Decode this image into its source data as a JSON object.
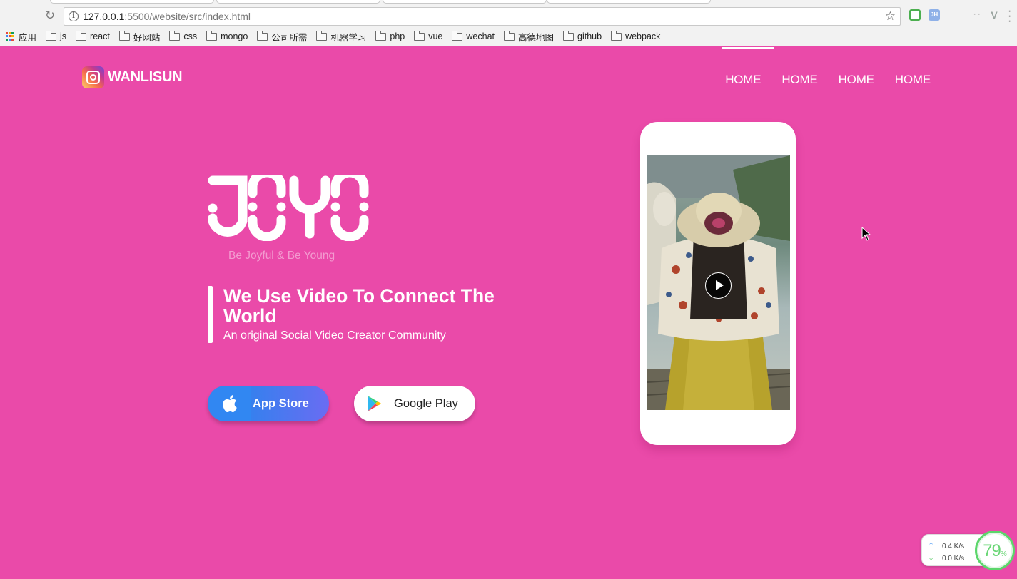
{
  "browser": {
    "url_host": "127.0.0.1",
    "url_rest": ":5500/website/src/index.html",
    "bookmarks": [
      "应用",
      "js",
      "react",
      "好网站",
      "css",
      "mongo",
      "公司所需",
      "机器学习",
      "php",
      "vue",
      "wechat",
      "高德地图",
      "github",
      "webpack"
    ],
    "extension_jh": "JH"
  },
  "header": {
    "logo_text": "WANLISUN",
    "nav": [
      "HOME",
      "HOME",
      "HOME",
      "HOME"
    ]
  },
  "hero": {
    "brand_word": "JOYO",
    "tagline": "Be Joyful & Be Young",
    "headline": "We Use Video To Connect The World",
    "subline": "An original Social Video Creator Community",
    "buttons": {
      "appstore_label": "App Store",
      "google_label": "Google Play"
    }
  },
  "phone": {
    "video_state": "paused"
  },
  "widget": {
    "upload_speed": "0.4 K/s",
    "download_speed": "0.0 K/s",
    "cpu_percent": "79",
    "percent_sign": "%"
  },
  "colors": {
    "page_bg": "#ea4aa9",
    "appstore_blue": "#3187f2",
    "gauge_green": "#5cd66b"
  }
}
